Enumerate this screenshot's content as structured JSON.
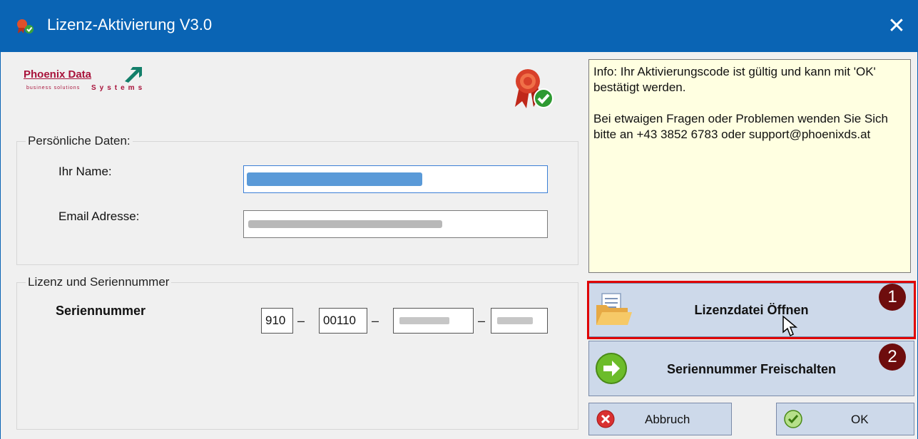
{
  "window": {
    "title": "Lizenz-Aktivierung V3.0",
    "close_glyph": "✕"
  },
  "logo": {
    "name": "Phoenix Data",
    "sub": "Systems",
    "tagline": "business solutions"
  },
  "personal": {
    "legend": "Persönliche Daten:",
    "name_label": "Ihr Name:",
    "name_value": "",
    "email_label": "Email Adresse:",
    "email_value": ""
  },
  "license": {
    "legend": "Lizenz und Seriennummer",
    "serial_label": "Seriennummer",
    "serial_parts": [
      "910",
      "00110",
      "",
      ""
    ],
    "separator": "–"
  },
  "info": {
    "line1": "Info: Ihr Aktivierungscode ist gültig und kann mit 'OK' bestätigt werden.",
    "line2": "Bei etwaigen Fragen oder Problemen wenden Sie Sich bitte an +43 3852 6783 oder support@phoenixds.at"
  },
  "buttons": {
    "open_license": "Lizenzdatei Öffnen",
    "activate_serial": "Seriennummer Freischalten",
    "cancel": "Abbruch",
    "ok": "OK"
  },
  "annotations": {
    "step1": "1",
    "step2": "2"
  },
  "colors": {
    "titlebar": "#0a64b4",
    "highlight": "#e00000",
    "badge": "#6e0d0d",
    "info_bg": "#ffffe1",
    "button_bg": "#cdd9ea"
  }
}
